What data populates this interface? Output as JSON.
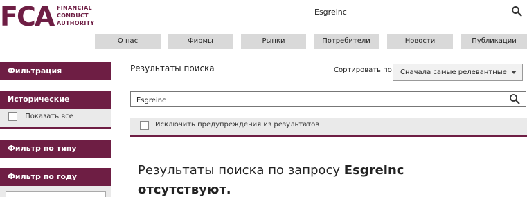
{
  "brand": {
    "logo_letters": "FCA",
    "logo_lines": [
      "FINANCIAL",
      "CONDUCT",
      "AUTHORITY"
    ],
    "accent_color": "#6e1e44"
  },
  "header": {
    "search_value": "Esgreinc",
    "search_icon": "search-icon"
  },
  "nav": {
    "items": [
      {
        "label": "О нас"
      },
      {
        "label": "Фирмы"
      },
      {
        "label": "Рынки"
      },
      {
        "label": "Потребители"
      },
      {
        "label": "Новости"
      },
      {
        "label": "Публикации"
      }
    ]
  },
  "sidebar": {
    "filter_results": "Фильтрация результатов",
    "historic_publications": "Исторические публикации",
    "show_all": "Показать все",
    "doc_type_filter": "Фильтр по типу документа",
    "year_filter": "Фильтр по году"
  },
  "main": {
    "title": "Результаты поиска",
    "sort_label": "Сортировать по:",
    "sort_value": "Сначала самые релевантные",
    "search_value": "Esgreinc",
    "exclude_label": "Исключить предупреждения из результатов",
    "no_results_prefix": "Результаты поиска по запросу ",
    "no_results_query": "Esgreinc",
    "no_results_suffix": "отсутствуют."
  }
}
